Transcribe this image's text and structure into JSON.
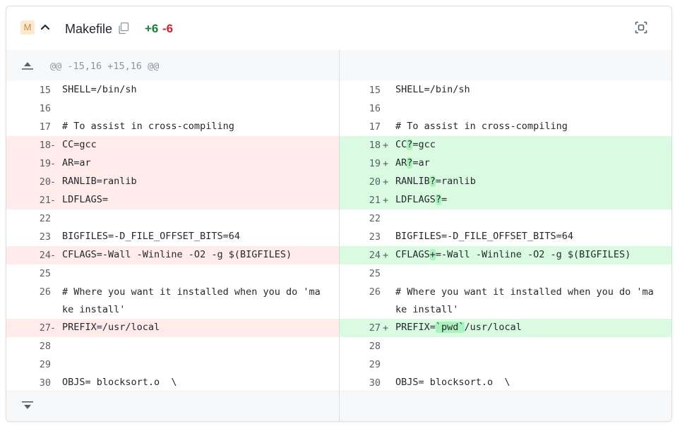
{
  "file": {
    "status_badge": "M",
    "collapse_glyph": "^",
    "name": "Makefile",
    "additions": "+6",
    "deletions": "-6",
    "icons": {
      "collapse": "chevron-up-icon",
      "copy": "copy-icon",
      "focus": "focus-mode-icon",
      "expand_up": "expand-up-icon",
      "expand_down": "expand-down-icon"
    }
  },
  "hunk_header": "@@ -15,16 +15,16 @@",
  "colors": {
    "deletion_bg": "#ffebe9",
    "addition_bg": "#dafbe1",
    "addition_highlight": "#abf2bc",
    "additions_text": "#1a7f37",
    "deletions_text": "#cf222e",
    "status_badge_bg": "#fde8cf"
  },
  "rows": [
    {
      "left": {
        "num": "15",
        "sign": "",
        "code": "SHELL=/bin/sh",
        "type": "ctx"
      },
      "right": {
        "num": "15",
        "sign": "",
        "parts": [
          "SHELL=/bin/sh"
        ],
        "type": "ctx"
      }
    },
    {
      "left": {
        "num": "16",
        "sign": "",
        "code": "",
        "type": "ctx"
      },
      "right": {
        "num": "16",
        "sign": "",
        "parts": [
          ""
        ],
        "type": "ctx"
      }
    },
    {
      "left": {
        "num": "17",
        "sign": "",
        "code": "# To assist in cross-compiling",
        "type": "ctx"
      },
      "right": {
        "num": "17",
        "sign": "",
        "parts": [
          "# To assist in cross-compiling"
        ],
        "type": "ctx"
      }
    },
    {
      "left": {
        "num": "18",
        "sign": "-",
        "code": "CC=gcc",
        "type": "del"
      },
      "right": {
        "num": "18",
        "sign": "+",
        "parts": [
          "CC",
          "?",
          "=gcc"
        ],
        "type": "add"
      }
    },
    {
      "left": {
        "num": "19",
        "sign": "-",
        "code": "AR=ar",
        "type": "del"
      },
      "right": {
        "num": "19",
        "sign": "+",
        "parts": [
          "AR",
          "?",
          "=ar"
        ],
        "type": "add"
      }
    },
    {
      "left": {
        "num": "20",
        "sign": "-",
        "code": "RANLIB=ranlib",
        "type": "del"
      },
      "right": {
        "num": "20",
        "sign": "+",
        "parts": [
          "RANLIB",
          "?",
          "=ranlib"
        ],
        "type": "add"
      }
    },
    {
      "left": {
        "num": "21",
        "sign": "-",
        "code": "LDFLAGS=",
        "type": "del"
      },
      "right": {
        "num": "21",
        "sign": "+",
        "parts": [
          "LDFLAGS",
          "?",
          "="
        ],
        "type": "add"
      }
    },
    {
      "left": {
        "num": "22",
        "sign": "",
        "code": "",
        "type": "ctx"
      },
      "right": {
        "num": "22",
        "sign": "",
        "parts": [
          ""
        ],
        "type": "ctx"
      }
    },
    {
      "left": {
        "num": "23",
        "sign": "",
        "code": "BIGFILES=-D_FILE_OFFSET_BITS=64",
        "type": "ctx"
      },
      "right": {
        "num": "23",
        "sign": "",
        "parts": [
          "BIGFILES=-D_FILE_OFFSET_BITS=64"
        ],
        "type": "ctx"
      }
    },
    {
      "left": {
        "num": "24",
        "sign": "-",
        "code": "CFLAGS=-Wall -Winline -O2 -g $(BIGFILES)",
        "type": "del"
      },
      "right": {
        "num": "24",
        "sign": "+",
        "parts": [
          "CFLAGS",
          "+",
          "=-Wall -Winline -O2 -g $(BIGFILES)"
        ],
        "type": "add"
      }
    },
    {
      "left": {
        "num": "25",
        "sign": "",
        "code": "",
        "type": "ctx"
      },
      "right": {
        "num": "25",
        "sign": "",
        "parts": [
          ""
        ],
        "type": "ctx"
      }
    },
    {
      "left": {
        "num": "26",
        "sign": "",
        "code": "# Where you want it installed when you do 'make install'",
        "type": "ctx",
        "tall": true
      },
      "right": {
        "num": "26",
        "sign": "",
        "parts": [
          "# Where you want it installed when you do 'make install'"
        ],
        "type": "ctx",
        "tall": true
      }
    },
    {
      "left": {
        "num": "27",
        "sign": "-",
        "code": "PREFIX=/usr/local",
        "type": "del"
      },
      "right": {
        "num": "27",
        "sign": "+",
        "parts": [
          "PREFIX=",
          "`pwd`",
          "/usr/local"
        ],
        "type": "add"
      }
    },
    {
      "left": {
        "num": "28",
        "sign": "",
        "code": "",
        "type": "ctx"
      },
      "right": {
        "num": "28",
        "sign": "",
        "parts": [
          ""
        ],
        "type": "ctx"
      }
    },
    {
      "left": {
        "num": "29",
        "sign": "",
        "code": "",
        "type": "ctx"
      },
      "right": {
        "num": "29",
        "sign": "",
        "parts": [
          ""
        ],
        "type": "ctx"
      }
    },
    {
      "left": {
        "num": "30",
        "sign": "",
        "code": "OBJS= blocksort.o  \\",
        "type": "ctx"
      },
      "right": {
        "num": "30",
        "sign": "",
        "parts": [
          "OBJS= blocksort.o  \\"
        ],
        "type": "ctx"
      }
    }
  ]
}
